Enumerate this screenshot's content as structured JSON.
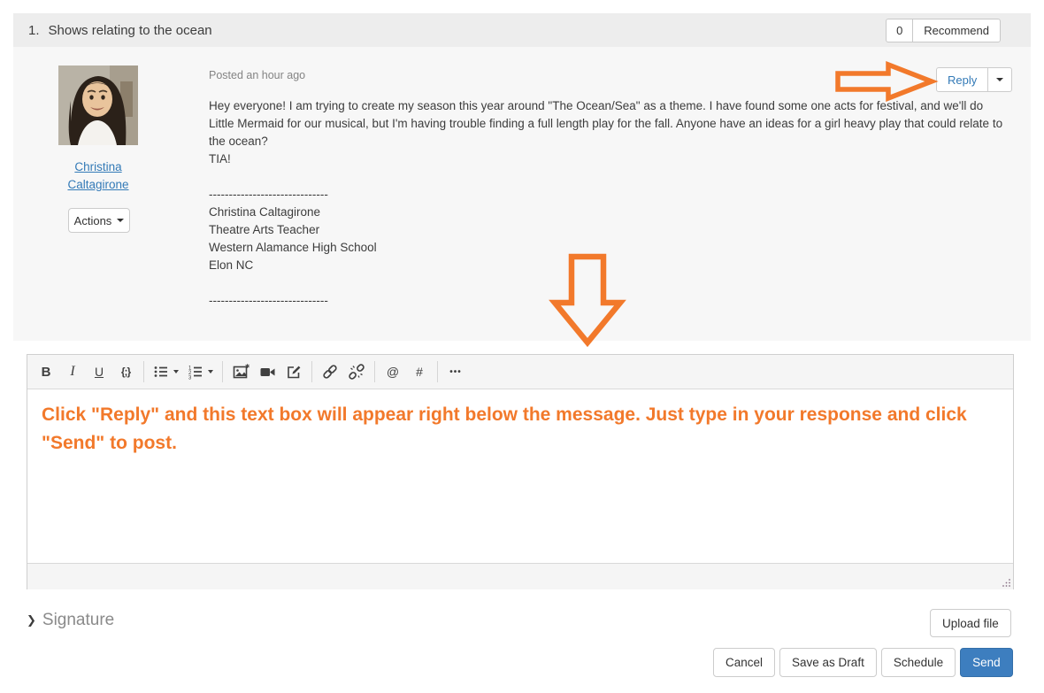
{
  "header": {
    "number": "1.",
    "title": "Shows relating to the ocean",
    "recommend_count": "0",
    "recommend_label": "Recommend"
  },
  "post": {
    "meta": "Posted an hour ago",
    "reply_label": "Reply",
    "author_name_line1": "Christina",
    "author_name_line2": "Caltagirone",
    "actions_label": "Actions",
    "body": {
      "paragraph": "Hey everyone! I am trying to create my season this year around \"The Ocean/Sea\" as a theme. I have found some one acts for festival, and we'll do Little Mermaid for our musical, but I'm having trouble finding a full length play for the fall. Anyone have an ideas for a girl heavy play that could relate to the ocean?",
      "tia": "TIA!",
      "sig_divider": "------------------------------",
      "sig_name": "Christina Caltagirone",
      "sig_title": "Theatre Arts Teacher",
      "sig_school": "Western Alamance High School",
      "sig_city": "Elon NC"
    }
  },
  "editor": {
    "glyphs": {
      "bold": "B",
      "italic": "I",
      "underline": "U",
      "code": "{;}",
      "at": "@",
      "hash": "#",
      "more": "•••"
    },
    "icons": [
      "bold",
      "italic",
      "underline",
      "code-view",
      "bullet-list",
      "numbered-list",
      "insert-image",
      "insert-video",
      "compose",
      "insert-link",
      "remove-link",
      "mention",
      "hashtag",
      "more-options"
    ],
    "annotation": "Click \"Reply\" and this text box will appear right below the message. Just type in your response and click \"Send\" to post."
  },
  "signature_section": {
    "chevron": "❯",
    "label": "Signature"
  },
  "upload_label": "Upload file",
  "actions_bar": {
    "cancel": "Cancel",
    "save_draft": "Save as Draft",
    "schedule": "Schedule",
    "send": "Send"
  },
  "colors": {
    "accent_orange": "#F2792B",
    "link_blue": "#337AB7",
    "send_blue": "#3D7EBF"
  }
}
